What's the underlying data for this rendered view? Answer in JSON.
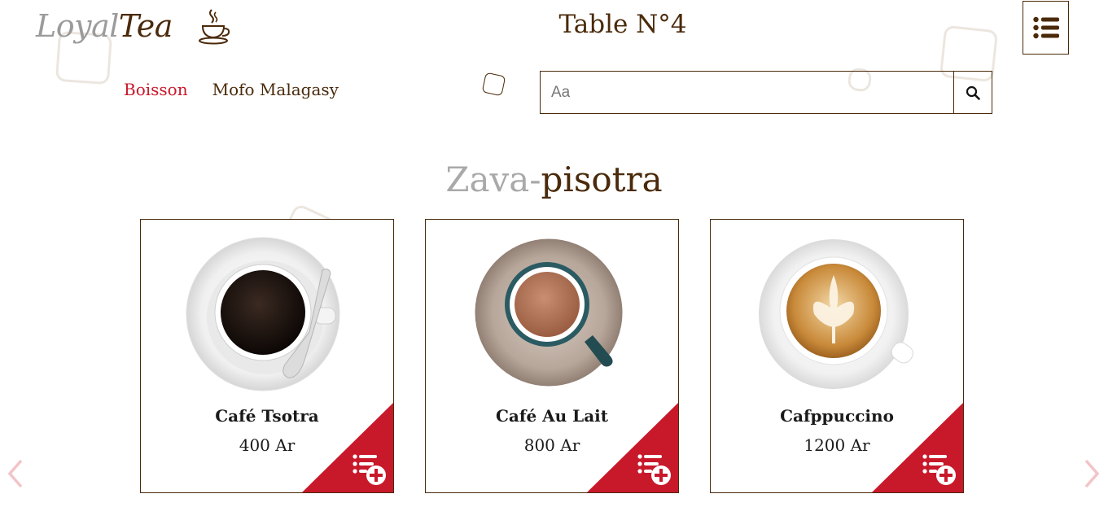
{
  "brand": {
    "part1": "Loyal",
    "part2": "Tea"
  },
  "header": {
    "table_label": "Table N°4"
  },
  "nav": {
    "categories": [
      {
        "label": "Boisson",
        "active": true
      },
      {
        "label": "Mofo Malagasy",
        "active": false
      }
    ]
  },
  "search": {
    "placeholder": "Aa",
    "value": ""
  },
  "section": {
    "title_part1": "Zava-",
    "title_part2": "pisotra"
  },
  "products": [
    {
      "name": "Café Tsotra",
      "price": "400 Ar"
    },
    {
      "name": "Café Au Lait",
      "price": "800 Ar"
    },
    {
      "name": "Cafppuccino",
      "price": "1200 Ar"
    }
  ],
  "colors": {
    "accent": "#c8192b",
    "brown": "#4a2a0a",
    "muted": "#a9a9a9"
  },
  "icons": [
    "coffee-cup-icon",
    "list-menu-icon",
    "search-icon",
    "add-to-order-icon",
    "chevron-left-icon",
    "chevron-right-icon"
  ]
}
